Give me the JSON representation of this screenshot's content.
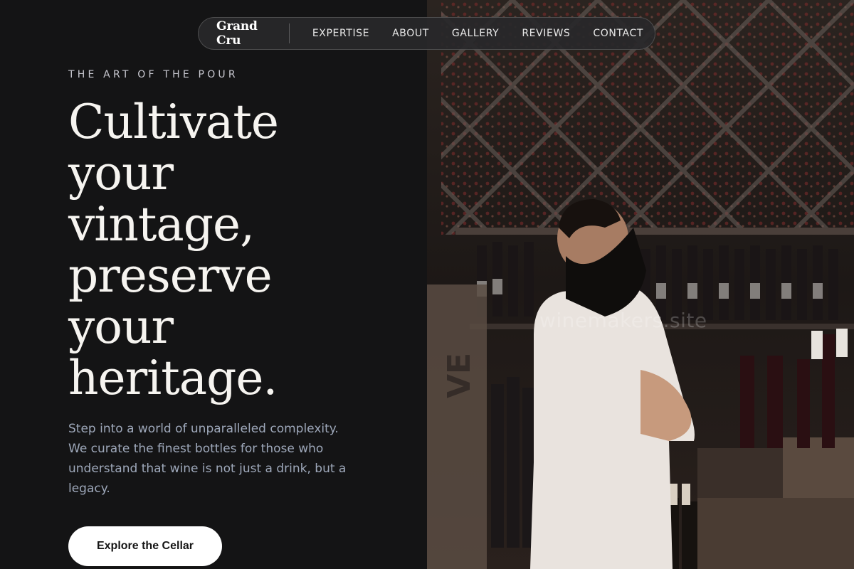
{
  "nav": {
    "brand": "Grand Cru",
    "links": [
      "EXPERTISE",
      "ABOUT",
      "GALLERY",
      "REVIEWS",
      "CONTACT"
    ]
  },
  "hero": {
    "eyebrow": "THE ART OF THE POUR",
    "headline_lines": [
      "Cultivate",
      "your",
      "vintage,",
      "preserve",
      "your",
      "heritage."
    ],
    "description": "Step into a world of unparalleled complexity. We curate the finest bottles for those who understand that wine is not just a drink, but a legacy.",
    "cta_label": "Explore the Cellar"
  },
  "image": {
    "watermark": "winemakers.site",
    "box_text": "VE"
  },
  "colors": {
    "background": "#141415",
    "accent_text": "#9ea8ba",
    "button": "#ffffff"
  }
}
